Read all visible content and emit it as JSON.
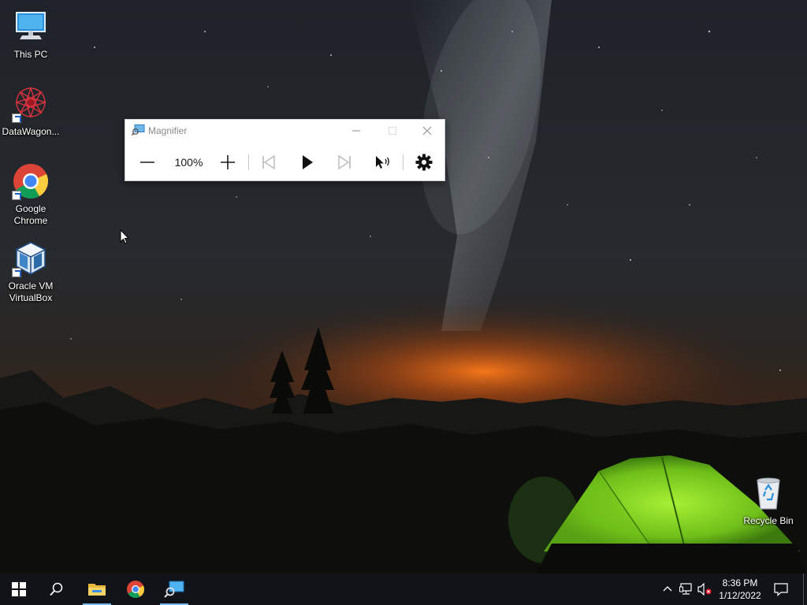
{
  "desktop": {
    "icons": [
      {
        "label_line1": "This PC",
        "label_line2": "",
        "icon": "computer-icon"
      },
      {
        "label_line1": "DataWagon...",
        "label_line2": "",
        "icon": "datawagon-icon"
      },
      {
        "label_line1": "Google",
        "label_line2": "Chrome",
        "icon": "chrome-icon"
      },
      {
        "label_line1": "Oracle VM",
        "label_line2": "VirtualBox",
        "icon": "virtualbox-icon"
      },
      {
        "label_line1": "Recycle Bin",
        "label_line2": "",
        "icon": "recycle-bin-icon"
      }
    ]
  },
  "magnifier": {
    "title": "Magnifier",
    "zoom_level": "100%",
    "buttons": {
      "zoom_out": "zoom-out-icon",
      "zoom_in": "zoom-in-icon",
      "previous": "previous-icon",
      "play": "play-icon",
      "next": "next-icon",
      "read_from_here": "read-from-here-icon",
      "settings": "gear-icon"
    }
  },
  "taskbar": {
    "apps": [
      "windows-start-icon",
      "search-icon",
      "file-explorer-icon",
      "chrome-icon",
      "magnifier-icon"
    ],
    "tray": [
      "chevron-up-icon",
      "network-icon",
      "volume-muted-icon",
      "notification-icon"
    ],
    "clock": {
      "time": "8:36 PM",
      "date": "1/12/2022"
    }
  },
  "colors": {
    "taskbar_bg": "#101318",
    "accent": "#76b9ed",
    "tent_green": "#8edc2a",
    "horizon_glow": "#e86a12"
  }
}
